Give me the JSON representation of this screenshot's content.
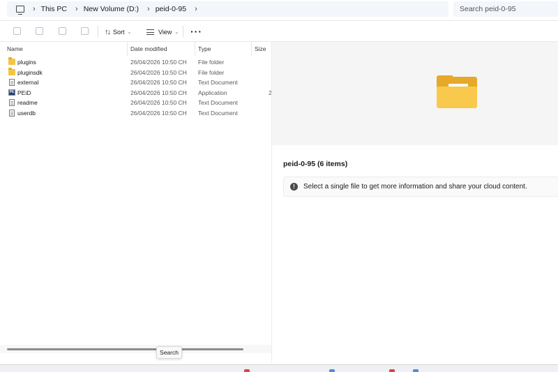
{
  "address_bar": {
    "crumbs": [
      "This PC",
      "New Volume (D:)",
      "peid-0-95"
    ],
    "search_placeholder": "Search peid-0-95"
  },
  "command_bar": {
    "sort_label": "Sort",
    "view_label": "View",
    "more_label": "···"
  },
  "file_list": {
    "columns": [
      "Name",
      "Date modified",
      "Type",
      "Size"
    ],
    "rows": [
      {
        "name": "plugins",
        "date": "26/04/2026 10:50 CH",
        "type": "File folder",
        "size": "",
        "icon": "folder-icon"
      },
      {
        "name": "pluginsdk",
        "date": "26/04/2026 10:50 CH",
        "type": "File folder",
        "size": "",
        "icon": "folder-icon"
      },
      {
        "name": "external",
        "date": "26/04/2026 10:50 CH",
        "type": "Text Document",
        "size": "",
        "icon": "text-document-icon"
      },
      {
        "name": "PEiD",
        "date": "26/04/2026 10:50 CH",
        "type": "Application",
        "size": "2",
        "icon": "peid-app-icon"
      },
      {
        "name": "readme",
        "date": "26/04/2026 10:50 CH",
        "type": "Text Document",
        "size": "",
        "icon": "text-document-icon"
      },
      {
        "name": "userdb",
        "date": "26/04/2026 10:50 CH",
        "type": "Text Document",
        "size": "",
        "icon": "text-document-icon"
      }
    ]
  },
  "tooltip": {
    "text": "Search"
  },
  "details_pane": {
    "title": "peid-0-95 (6 items)",
    "info_message": "Select a single file to get more information and share your cloud content."
  }
}
